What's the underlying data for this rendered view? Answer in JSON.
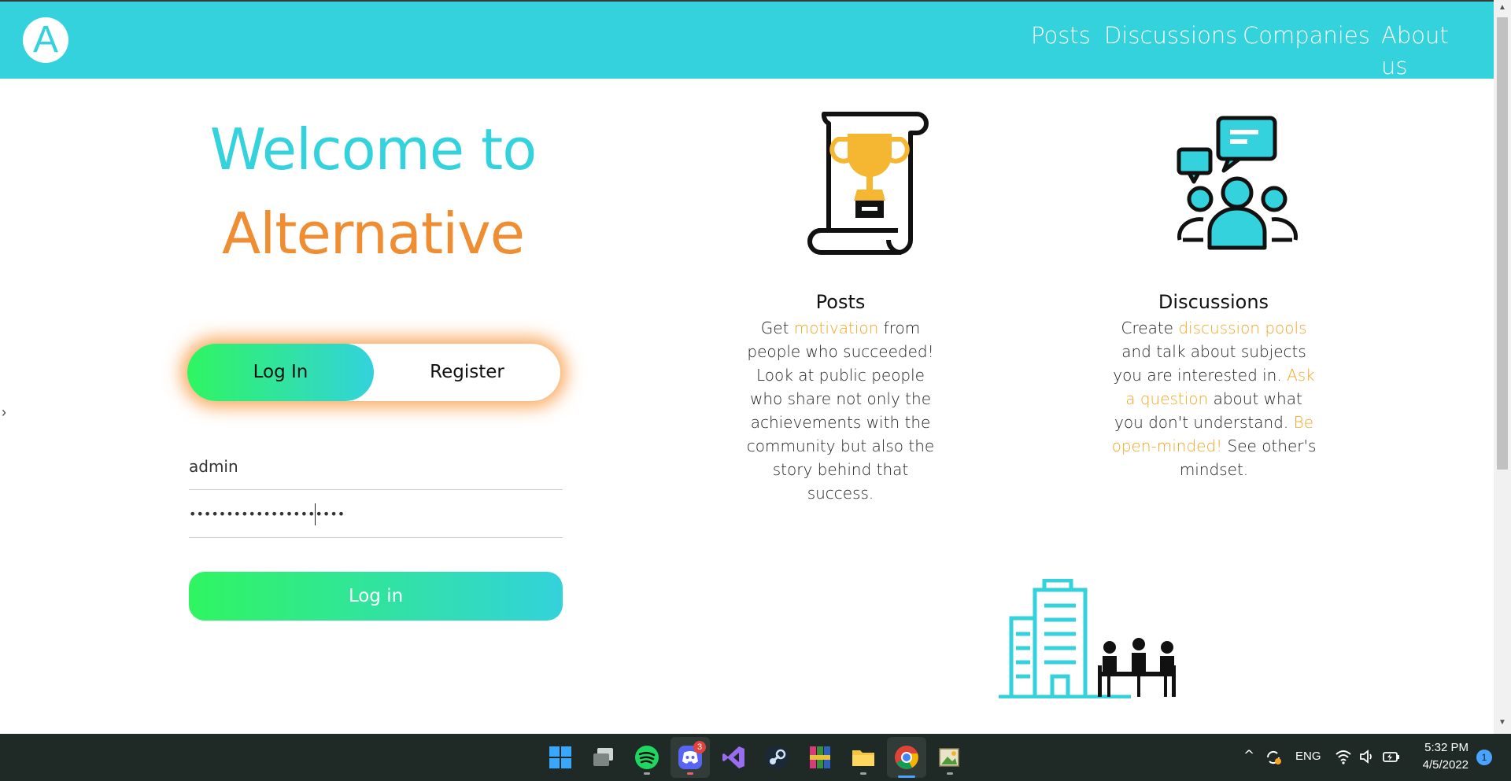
{
  "header": {
    "logo_letter": "A",
    "nav": {
      "posts": "Posts",
      "discussions": "Discussions",
      "companies": "Companies",
      "about": "About us"
    }
  },
  "welcome": {
    "line1": "Welcome to",
    "line2": "Alternative"
  },
  "auth": {
    "login_tab": "Log In",
    "register_tab": "Register",
    "username_value": "admin",
    "password_value": "•••••••••••••••••••••",
    "submit_label": "Log in"
  },
  "features": {
    "posts": {
      "title": "Posts",
      "text_parts": [
        "Get ",
        "motivation",
        " from people who succeeded! Look at public people who share not only the achievements with the community but also the story behind that success."
      ]
    },
    "discussions": {
      "title": "Discussions",
      "text_parts": [
        "Create ",
        "discussion pools",
        " and talk about subjects you are interested in. ",
        "Ask a question",
        " about what you don't understand. ",
        "Be open-minded!",
        " See other's mindset."
      ]
    }
  },
  "colors": {
    "brand_cyan": "#33d2dc",
    "brand_orange": "#ef8d32",
    "gradient_green": "#2ff561",
    "highlight": "#f5a623"
  },
  "taskbar": {
    "apps": [
      "windows-start-icon",
      "task-view-icon",
      "spotify-icon",
      "discord-icon",
      "visual-studio-icon",
      "steam-icon",
      "winrar-icon",
      "file-explorer-icon",
      "chrome-icon",
      "image-viewer-icon"
    ],
    "discord_badge": "3",
    "language": "ENG",
    "time": "5:32 PM",
    "date": "4/5/2022",
    "notification_count": "1"
  }
}
